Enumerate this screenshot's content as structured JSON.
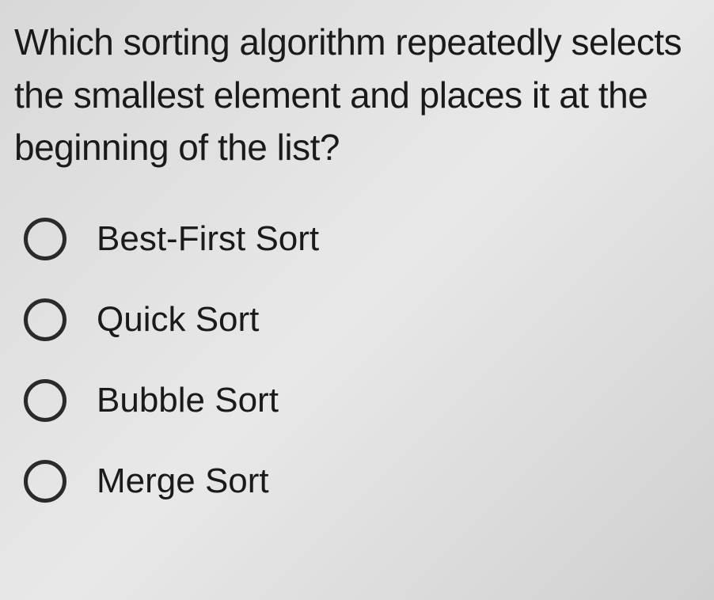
{
  "question": "Which sorting algorithm repeatedly selects the smallest element and places it at the beginning of the list?",
  "options": [
    {
      "label": "Best-First Sort",
      "selected": false
    },
    {
      "label": "Quick Sort",
      "selected": false
    },
    {
      "label": "Bubble Sort",
      "selected": false
    },
    {
      "label": "Merge Sort",
      "selected": false
    }
  ]
}
